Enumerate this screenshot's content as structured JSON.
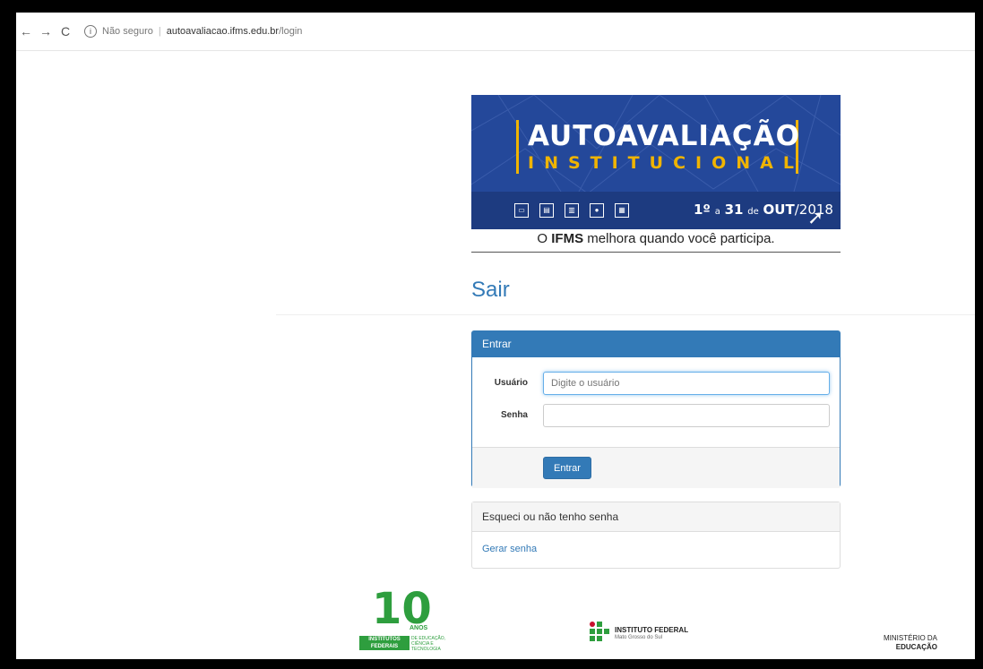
{
  "browser": {
    "back_icon": "arrow-left-icon",
    "forward_icon": "arrow-right-icon",
    "reload_icon": "reload-icon",
    "security_text": "Não seguro",
    "url_domain": "autoavaliacao.ifms.edu.br",
    "url_path": "/login"
  },
  "banner": {
    "title_line1": "AUTOAVALIAÇÃO",
    "title_line2": "INSTITUCIONAL",
    "dates_start": "1º",
    "dates_a": "a",
    "dates_end": "31",
    "dates_de": "de",
    "dates_month": "OUT",
    "dates_year": "/2018",
    "tagline_pre": "O",
    "tagline_bold": "IFMS",
    "tagline_post": "melhora quando você participa."
  },
  "page": {
    "title": "Sair"
  },
  "login_panel": {
    "heading": "Entrar",
    "user_label": "Usuário",
    "user_placeholder": "Digite o usuário",
    "password_label": "Senha",
    "submit_label": "Entrar"
  },
  "forgot_panel": {
    "heading": "Esqueci ou não tenho senha",
    "link_label": "Gerar senha"
  },
  "footer": {
    "anniversary_number": "10",
    "anniversary_anos": "ANOS",
    "anniversary_inst": "INSTITUTOS FEDERAIS",
    "anniversary_desc": "DE EDUCAÇÃO, CIÊNCIA E TECNOLOGIA",
    "if_name": "INSTITUTO FEDERAL",
    "if_campus": "Mato Grosso do Sul",
    "mec_line1": "MINISTÉRIO DA",
    "mec_line2": "EDUCAÇÃO"
  },
  "colors": {
    "primary": "#337ab7",
    "banner_blue": "#24489a",
    "banner_yellow": "#f0b400",
    "if_green": "#2e9e3e",
    "if_red": "#c8102e"
  }
}
